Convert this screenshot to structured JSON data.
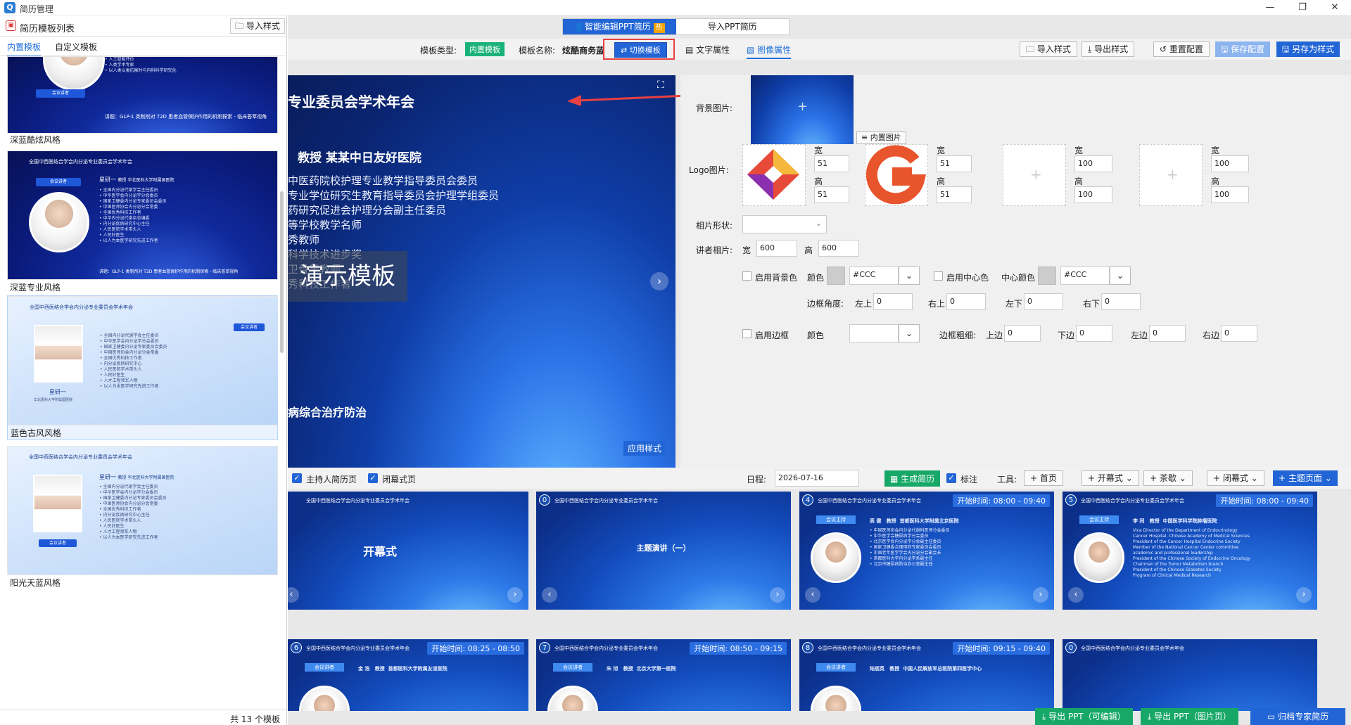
{
  "window": {
    "title": "简历管理",
    "icon": "Q"
  },
  "left_panel": {
    "title": "简历模板列表",
    "import_style": "导入样式",
    "tabs": [
      "内置模板",
      "自定义模板"
    ],
    "templates": [
      {
        "name": "深蓝酷炫风格",
        "header": "",
        "speech": "讲题：GLP-1 类制剂对 T2D 患者血管保护作用的机制探索 - 临床荟萃视角",
        "lines": "• 人工智能评价\n• 人类学术专家\n• 以人类以类抗衡时与内科科学研究化"
      },
      {
        "name": "深蓝专业风格",
        "header": "全国中西医结合学会内分泌专业委员会学术年会",
        "tag": "会议讲者",
        "speaker": "星研一",
        "title": "教授  华北医科大学附属国医院",
        "lines": "• 全国内分泌代谢学会主任委员\n• 中华医学会内分泌学分会委员\n• 国家卫健委内分泌专家委员会委员\n• 中国医师协会内分泌分会常委\n• 全国优秀科技工作者\n• 中华内分泌代谢杂志编委\n• 内分泌疾病研究中心主任\n• 人民医院学术带头人\n• 人民好医生\n• 以人为本医学研究先进工作者",
        "speech": "讲题：GLP-1 类制剂对 T2D 患者血管保护作用的机制探索 - 临床荟萃视角"
      },
      {
        "name": "蓝色古风风格",
        "header": "全国中西医结合学会内分泌专业委员会学术年会",
        "tag": "会议讲者",
        "speaker": "星研一",
        "sub": "华北医科大学附属国医院",
        "lines": "• 全国内分泌代谢学会主任委员\n• 中华医学会内分泌学分会委员\n• 国家卫健委内分泌专家委员会委员\n• 中国医师协会内分泌分会常委\n• 全国优秀科技工作者\n• 内分泌疾病研究中心\n• 人民医院学术带头人\n• 人民好医生\n• 人才工程领军人物\n• 以人为本医学研究先进工作者"
      },
      {
        "name": "阳光天蓝风格",
        "header": "全国中西医结合学会内分泌专业委员会学术年会",
        "tag": "会议讲者",
        "speaker": "星研一",
        "title": "教授  华北医科大学附属国医院",
        "lines": "• 全国内分泌代谢学会主任委员\n• 中华医学会内分泌学分会委员\n• 国家卫健委内分泌专家委员会委员\n• 中国医师协会内分泌分会常委\n• 全国优秀科技工作者\n• 内分泌疾病研究中心主任\n• 人民医院学术带头人\n• 人民好医生\n• 人才工程领军人物\n• 以人为本医学研究先进工作者"
      }
    ],
    "count": "共 13 个模板"
  },
  "main": {
    "mode_tabs": [
      {
        "label": "智能编辑PPT简历",
        "badge": "热"
      },
      {
        "label": "导入PPT简历"
      }
    ],
    "toolbar": {
      "template_type_label": "模板类型:",
      "template_type_value": "内置模板",
      "template_name_label": "模板名称:",
      "template_name_value": "炫酷商务蓝",
      "switch_template": "切换模板",
      "tab_text": "文字属性",
      "tab_image": "图像属性",
      "import_style": "导入样式",
      "export_style": "导出样式",
      "reset_config": "重置配置",
      "save_config": "保存配置",
      "save_as_style": "另存为样式"
    },
    "preview": {
      "title": "专业委员会学术年会",
      "name_line": "教授  某某中日友好医院",
      "lines": "中医药院校护理专业教学指导委员会委员\n专业学位研究生教育指导委员会护理学组委员\n药研究促进会护理分会副主任委员\n等学校教学名师\n秀教师\n科学技术进步奖\n卫骨干教师\n秀科技工作者",
      "watermark": "演示模板",
      "footer": "病综合治疗防治",
      "apply": "应用样式"
    },
    "image_props": {
      "bg_label": "背景图片:",
      "builtin_image": "内置图片",
      "logo_label": "Logo图片:",
      "w": "宽",
      "h": "高",
      "logos": [
        {
          "w": "51",
          "h": "51"
        },
        {
          "w": "51",
          "h": "51"
        },
        {
          "w": "100",
          "h": "100"
        },
        {
          "w": "100",
          "h": "100"
        }
      ],
      "photo_shape_label": "相片形状:",
      "speaker_photo_label": "讲者相片:",
      "photo_w": "600",
      "photo_h": "600",
      "enable_bg_color": "启用背景色",
      "color_label": "颜色",
      "bg_color_value": "#CCC",
      "enable_center_color": "启用中心色",
      "center_color_label": "中心颜色",
      "center_color_value": "#CCC",
      "border_radius_label": "边框角度:",
      "tl": "左上",
      "tr": "右上",
      "bl": "左下",
      "br": "右下",
      "radius_values": [
        "0",
        "0",
        "0",
        "0"
      ],
      "enable_border": "启用边框",
      "border_width_label": "边框粗细:",
      "top": "上边",
      "bottom": "下边",
      "left": "左边",
      "right": "右边",
      "border_values": [
        "0",
        "0",
        "0",
        "0"
      ]
    },
    "bottom_toolbar": {
      "host_resume": "主持人简历页",
      "closing_page": "闭幕式页",
      "date_label": "日程:",
      "date_value": "2026-07-16",
      "generate": "生成简历",
      "annotate": "标注",
      "tools_label": "工具:",
      "home": "首页",
      "opening": "开幕式",
      "tea_break": "茶歇",
      "closing": "闭幕式",
      "topic_page": "主题页面"
    },
    "slides_row1": [
      {
        "num": "",
        "header": "全国中西医结合学会内分泌专业委员会学术年会",
        "center": "开幕式"
      },
      {
        "num": "0",
        "header": "全国中西医结合学会内分泌专业委员会学术年会",
        "center": "主题演讲（一）"
      },
      {
        "num": "4",
        "header": "全国中西医结合学会内分泌专业委员会学术年会",
        "time": "开始时间: 08:00 - 09:40",
        "tag": "会议主持",
        "speaker": "高 健   教授  首都医科大学附属北京医院",
        "lines": "• 中国医师协会内分泌代谢科医师分会委员\n• 中华医学会糖尿病学分会委员\n• 北京医学会内分泌学分会副主任委员\n• 国家卫健委合理用药专家委员会委员\n• 中国老年医学学会内分泌分会副会长\n• 首都医科大学内分泌学系副主任\n• 北京市糖尿病防治办公室副主任"
      },
      {
        "num": "5",
        "header": "全国中西医结合学会内分泌专业委员会学术年会",
        "time": "开始时间: 08:00 - 09:40",
        "tag": "会议主持",
        "speaker": "李 同   教授  中国医学科学院肿瘤医院",
        "lines": "Vice Director of the Department of Endocrinology\nCancer Hospital, Chinese Academy of Medical Sciences\nPresident of the Cancer Hospital Endocrine Society\nMember of the National Cancer Center committee\nacademic and professional leadership\nPresident of the Chinese Society of Endocrine Oncology\nChairman of the Tumor Metabolism branch\nPresident of the Chinese Diabetes Society\nProgram of Clinical Medical Research"
      }
    ],
    "slides_row2": [
      {
        "num": "6",
        "header": "全国中西医结合学会内分泌专业委员会学术年会",
        "time": "开始时间: 08:25 - 08:50",
        "tag": "会议讲者",
        "speaker": "金 浩   教授  首都医科大学附属友谊医院"
      },
      {
        "num": "7",
        "header": "全国中西医结合学会内分泌专业委员会学术年会",
        "time": "开始时间: 08:50 - 09:15",
        "tag": "会议讲者",
        "speaker": "朱 旭   教授  北京大学第一医院"
      },
      {
        "num": "8",
        "header": "全国中西医结合学会内分泌专业委员会学术年会",
        "time": "开始时间: 09:15 - 09:40",
        "tag": "会议讲者",
        "speaker": "陆丽英   教授  中国人民解放军总医院第四医学中心"
      },
      {
        "num": "0",
        "header": "全国中西医结合学会内分泌专业委员会学术年会"
      }
    ],
    "footer": {
      "export_editable": "导出 PPT（可编辑）",
      "export_image": "导出 PPT（图片页）",
      "archive": "归档专家简历"
    }
  }
}
